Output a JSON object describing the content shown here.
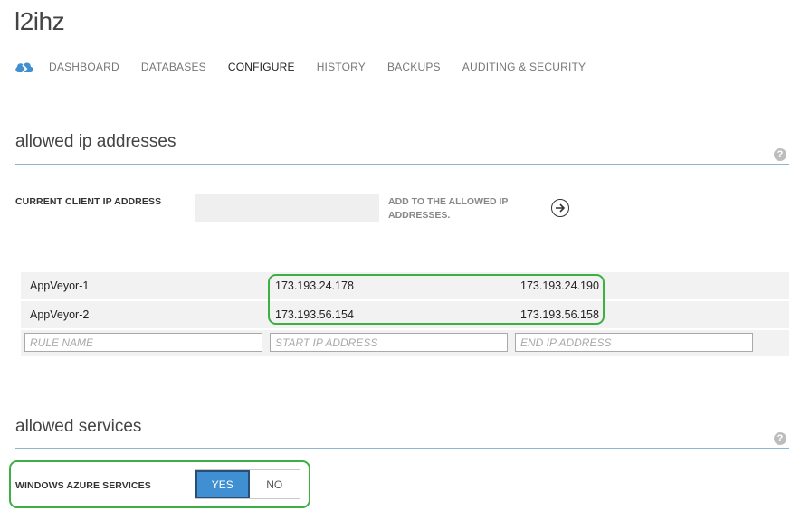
{
  "header": {
    "title": "l2ihz"
  },
  "nav": {
    "logo_icon": "azure-cloud-icon",
    "tabs": [
      {
        "label": "DASHBOARD",
        "active": false
      },
      {
        "label": "DATABASES",
        "active": false
      },
      {
        "label": "CONFIGURE",
        "active": true
      },
      {
        "label": "HISTORY",
        "active": false
      },
      {
        "label": "BACKUPS",
        "active": false
      },
      {
        "label": "AUDITING & SECURITY",
        "active": false
      }
    ]
  },
  "allowed_ip": {
    "section_title": "allowed ip addresses",
    "help_icon": "help-icon",
    "client_ip_label": "CURRENT CLIENT IP ADDRESS",
    "client_ip_value": "",
    "add_link": "ADD TO THE ALLOWED IP ADDRESSES.",
    "add_icon": "arrow-right-circle-icon",
    "rules": [
      {
        "name": "AppVeyor-1",
        "start": "173.193.24.178",
        "end": "173.193.24.190"
      },
      {
        "name": "AppVeyor-2",
        "start": "173.193.56.154",
        "end": "173.193.56.158"
      }
    ],
    "new_rule": {
      "name_placeholder": "RULE NAME",
      "start_placeholder": "START IP ADDRESS",
      "end_placeholder": "END IP ADDRESS"
    }
  },
  "allowed_services": {
    "section_title": "allowed services",
    "help_icon": "help-icon",
    "azure_label": "WINDOWS AZURE SERVICES",
    "toggle": {
      "yes": "YES",
      "no": "NO",
      "selected": "YES"
    }
  },
  "colors": {
    "accent": "#3f8fd2",
    "rule": "#8fb5cf",
    "highlight": "#3cb043"
  }
}
